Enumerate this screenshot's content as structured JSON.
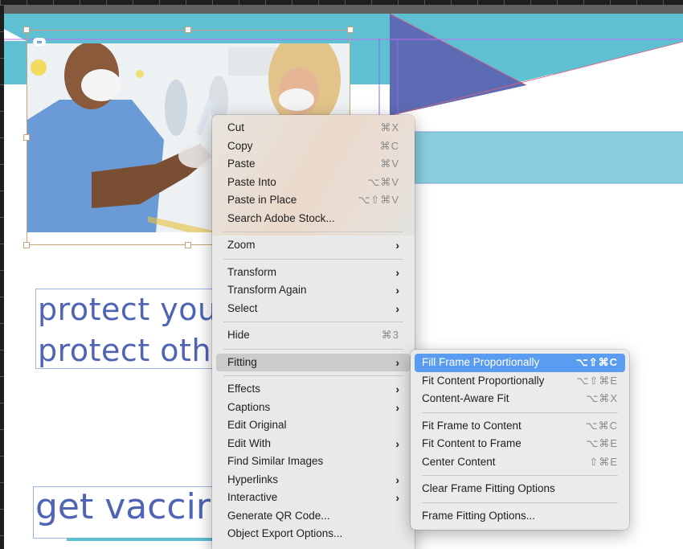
{
  "document": {
    "text_frame_1_lines": [
      "protect your",
      "protect othe"
    ],
    "text_frame_2": "get vaccir",
    "colors": {
      "banner_teal": "#5fbfd3",
      "triangle_indigo": "#5d6bb4",
      "light_band": "#8bcfde",
      "text_blue": "#5064b6",
      "highlight_blue": "#5a9cf0"
    }
  },
  "image_frame": {
    "link_icon": "link-icon"
  },
  "context_menu": {
    "groups": [
      [
        {
          "label": "Cut",
          "shortcut": "⌘X"
        },
        {
          "label": "Copy",
          "shortcut": "⌘C"
        },
        {
          "label": "Paste",
          "shortcut": "⌘V"
        },
        {
          "label": "Paste Into",
          "shortcut": "⌥⌘V"
        },
        {
          "label": "Paste in Place",
          "shortcut": "⌥⇧⌘V"
        },
        {
          "label": "Search Adobe Stock...",
          "shortcut": ""
        }
      ],
      [
        {
          "label": "Zoom",
          "submenu": true
        }
      ],
      [
        {
          "label": "Transform",
          "submenu": true
        },
        {
          "label": "Transform Again",
          "submenu": true
        },
        {
          "label": "Select",
          "submenu": true
        }
      ],
      [
        {
          "label": "Hide",
          "shortcut": "⌘3"
        }
      ],
      [
        {
          "label": "Fitting",
          "submenu": true,
          "hover": true
        }
      ],
      [
        {
          "label": "Effects",
          "submenu": true
        },
        {
          "label": "Captions",
          "submenu": true
        },
        {
          "label": "Edit Original"
        },
        {
          "label": "Edit With",
          "submenu": true
        },
        {
          "label": "Find Similar Images"
        },
        {
          "label": "Hyperlinks",
          "submenu": true
        },
        {
          "label": "Interactive",
          "submenu": true
        },
        {
          "label": "Generate QR Code..."
        },
        {
          "label": "Object Export Options..."
        }
      ]
    ],
    "arrow_glyph": "›"
  },
  "fitting_submenu": {
    "groups": [
      [
        {
          "label": "Fill Frame Proportionally",
          "shortcut": "⌥⇧⌘C",
          "active": true
        },
        {
          "label": "Fit Content Proportionally",
          "shortcut": "⌥⇧⌘E"
        },
        {
          "label": "Content-Aware Fit",
          "shortcut": "⌥⌘X"
        }
      ],
      [
        {
          "label": "Fit Frame to Content",
          "shortcut": "⌥⌘C"
        },
        {
          "label": "Fit Content to Frame",
          "shortcut": "⌥⌘E"
        },
        {
          "label": "Center Content",
          "shortcut": "⇧⌘E"
        }
      ],
      [
        {
          "label": "Clear Frame Fitting Options"
        }
      ],
      [
        {
          "label": "Frame Fitting Options..."
        }
      ]
    ]
  }
}
